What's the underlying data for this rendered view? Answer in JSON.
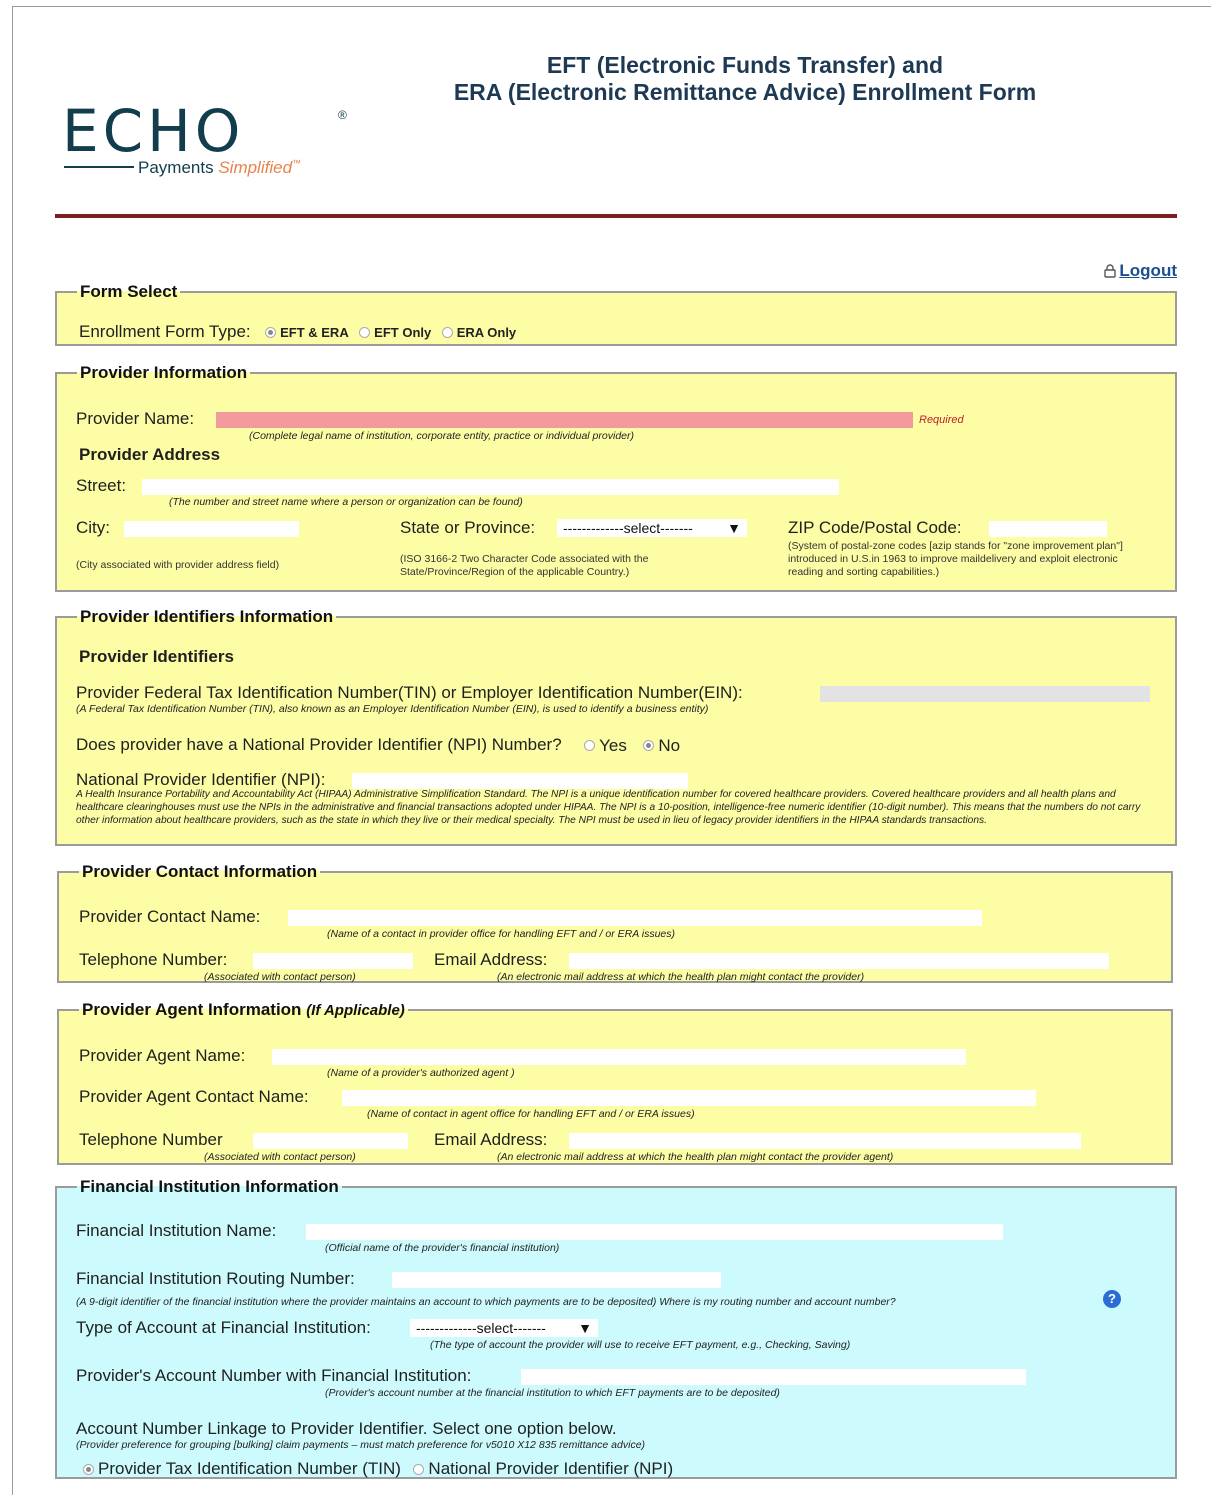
{
  "header": {
    "logo_text": "ECHO",
    "logo_reg": "®",
    "logo_tagline": "Payments",
    "logo_tagline_accent": "Simplified",
    "logo_tm": "™",
    "title_line1": "EFT (Electronic Funds Transfer) and",
    "title_line2": "ERA (Electronic Remittance Advice) Enrollment Form",
    "logout_label": "Logout"
  },
  "form_select": {
    "legend": "Form Select",
    "label": "Enrollment Form Type:",
    "options": [
      "EFT & ERA",
      "EFT Only",
      "ERA Only"
    ],
    "selected": "EFT & ERA"
  },
  "provider_info": {
    "legend": "Provider Information",
    "name_label": "Provider Name:",
    "name_required": "Required",
    "name_hint": "(Complete legal name of institution, corporate entity, practice or individual provider)",
    "address_heading": "Provider Address",
    "street_label": "Street:",
    "street_hint": "(The number and street name where a person or organization can be found)",
    "city_label": "City:",
    "city_hint": "(City associated with provider address field)",
    "state_label": "State or Province:",
    "state_select": "-------------select-------",
    "state_hint": "(ISO 3166-2 Two Character Code associated with the State/Province/Region of the applicable Country.)",
    "zip_label": "ZIP Code/Postal Code:",
    "zip_hint": "(System of postal-zone codes [azip stands for \"zone improvement plan\"] introduced in U.S.in 1963 to improve maildelivery and exploit electronic reading and sorting capabilities.)"
  },
  "identifiers": {
    "legend": "Provider Identifiers Information",
    "heading": "Provider Identifiers",
    "tin_label": "Provider Federal Tax Identification Number(TIN) or Employer Identification Number(EIN):",
    "tin_hint": "(A Federal Tax Identification Number (TIN), also known as an Employer Identification Number (EIN), is used to identify a business entity)",
    "npi_question": "Does provider have a National Provider Identifier (NPI) Number?",
    "npi_yes": "Yes",
    "npi_no": "No",
    "npi_selected": "No",
    "npi_label": "National Provider Identifier (NPI):",
    "npi_hint": "A Health Insurance Portability and Accountability Act (HIPAA) Administrative Simplification Standard. The NPI is a unique identification number for covered healthcare providers. Covered healthcare providers and all health plans and healthcare clearinghouses must use the NPIs in the administrative and financial transactions adopted under HIPAA. The NPI is a 10-position, intelligence-free numeric identifier (10-digit number). This means that the numbers do not carry other information about healthcare providers, such as the state in which they live or their medical specialty. The NPI must be used in lieu of legacy provider identifiers in the HIPAA standards transactions."
  },
  "contact": {
    "legend": "Provider Contact Information",
    "name_label": "Provider Contact Name:",
    "name_hint": "(Name of a contact in provider office for handling EFT and / or ERA issues)",
    "phone_label": "Telephone Number:",
    "phone_hint": "(Associated with contact person)",
    "email_label": "Email Address:",
    "email_hint": "(An electronic mail address at which the health plan might contact the provider)"
  },
  "agent": {
    "legend": "Provider Agent Information",
    "legend_note": "(If Applicable)",
    "name_label": "Provider Agent Name:",
    "name_hint": "(Name of a provider's authorized agent )",
    "contact_label": "Provider Agent Contact Name:",
    "contact_hint": "(Name of contact in agent office for handling EFT and / or ERA issues)",
    "phone_label": "Telephone Number",
    "phone_hint": "(Associated with contact person)",
    "email_label": "Email Address:",
    "email_hint": "(An electronic mail address at which the health plan might contact the provider agent)"
  },
  "financial": {
    "legend": "Financial Institution Information",
    "name_label": "Financial Institution Name:",
    "name_hint": "(Official name of the provider's financial institution)",
    "routing_label": "Financial Institution Routing Number:",
    "routing_hint": "(A 9-digit identifier of the financial institution where the provider maintains an account to which payments are to be deposited) Where is my routing number and account number?",
    "help_icon": "?",
    "acct_type_label": "Type of Account at Financial Institution:",
    "acct_type_select": "-------------select-------",
    "acct_type_hint": "(The type of account the provider will use to receive EFT payment, e.g., Checking, Saving)",
    "acct_num_label": "Provider's Account Number with Financial Institution:",
    "acct_num_hint": "(Provider's account number at the financial institution to which EFT payments are to be deposited)",
    "linkage_label": "Account Number Linkage to Provider Identifier. Select one option below.",
    "linkage_hint": "(Provider preference for grouping [bulking] claim payments – must match preference for v5010 X12 835 remittance advice)",
    "linkage_tin": "Provider Tax Identification Number (TIN)",
    "linkage_npi": "National Provider Identifier (NPI)",
    "linkage_selected": "TIN"
  }
}
